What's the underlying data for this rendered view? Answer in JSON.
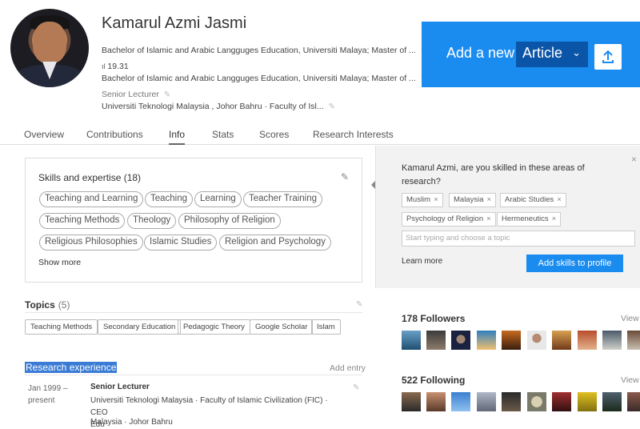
{
  "profile": {
    "name": "Kamarul Azmi Jasmi",
    "degree_line_1": "Bachelor of Islamic and Arabic Langguges Education, Universiti Malaya; Master of ...",
    "rg_score": "19.31",
    "degree_line_2": "Bachelor of Islamic and Arabic Langguges Education, Universiti Malaya; Master of ...",
    "position": "Senior Lecturer",
    "institution": "Universiti Teknologi Malaysia , Johor Bahru · Faculty of Isl..."
  },
  "add_article": {
    "label": "Add a new",
    "type_selected": "Article"
  },
  "tabs": [
    {
      "label": "Overview"
    },
    {
      "label": "Contributions"
    },
    {
      "label": "Info"
    },
    {
      "label": "Stats"
    },
    {
      "label": "Scores"
    },
    {
      "label": "Research Interests"
    }
  ],
  "skills": {
    "title": "Skills and expertise (18)",
    "tags": [
      "Teaching and Learning",
      "Teaching",
      "Learning",
      "Teacher Training",
      "Teaching Methods",
      "Theology",
      "Philosophy of Religion",
      "Religious Philosophies",
      "Islamic Studies",
      "Religion and Psychology"
    ],
    "show_more": "Show more"
  },
  "suggest": {
    "question": "Kamarul Azmi, are you skilled in these areas of research?",
    "chips": [
      "Muslim",
      "Malaysia",
      "Arabic Studies",
      "Psychology of Religion",
      "Hermeneutics"
    ],
    "input_placeholder": "Start typing and choose a topic",
    "learn_more": "Learn more",
    "add_button": "Add skills to profile"
  },
  "topics": {
    "title": "Topics",
    "count": "(5)",
    "items": [
      "Teaching Methods",
      "Secondary Education",
      "Pedagogic Theory",
      "Google Scholar",
      "Islam"
    ]
  },
  "research_experience": {
    "title": "Research experience",
    "add_entry": "Add entry",
    "date_from": "Jan 1999 –",
    "date_to": "present",
    "role": "Senior Lecturer",
    "org": "Universiti Teknologi Malaysia · Faculty of Islamic Civilization (FIC) · CEO",
    "org_cont": "Edu",
    "location": "Malaysia · Johor Bahru"
  },
  "followers": {
    "title": "178 Followers",
    "view": "View"
  },
  "following": {
    "title": "522 Following",
    "view": "View"
  },
  "colors": {
    "accent": "#1a8cf0",
    "dropdown": "#0b55a8",
    "highlight": "#3a7bd5"
  }
}
